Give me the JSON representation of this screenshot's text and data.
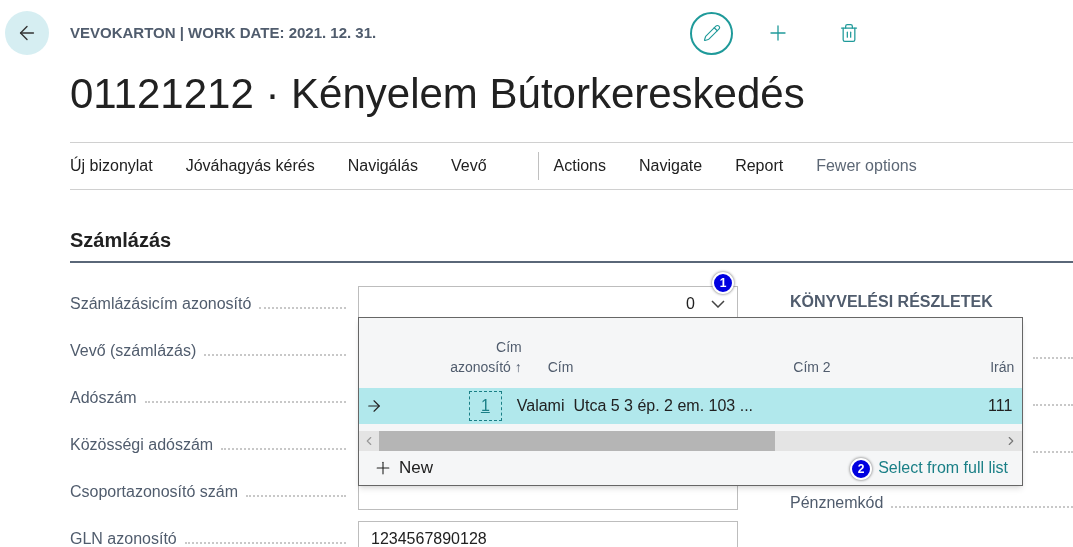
{
  "header": {
    "caption": "VEVOKARTON | WORK DATE: 2021. 12. 31.",
    "title": "01121212 · Kényelem Bútorkereskedés"
  },
  "actions": [
    {
      "label": "Új bizonylat",
      "kind": "promoted"
    },
    {
      "label": "Jóváhagyás kérés",
      "kind": "promoted"
    },
    {
      "label": "Navigálás",
      "kind": "promoted"
    },
    {
      "label": "Vevő",
      "kind": "promoted"
    },
    {
      "label": "Actions",
      "kind": "menu"
    },
    {
      "label": "Navigate",
      "kind": "menu"
    },
    {
      "label": "Report",
      "kind": "menu"
    },
    {
      "label": "Fewer options",
      "kind": "toggle"
    }
  ],
  "section": {
    "title": "Számlázás"
  },
  "fields": [
    {
      "label": "Számlázásicím azonosító",
      "value": "0",
      "kind": "dropdown"
    },
    {
      "label": "Vevő (számlázás)",
      "kind": "hidden"
    },
    {
      "label": "Adószám",
      "kind": "hidden"
    },
    {
      "label": "Közösségi adószám",
      "kind": "hidden"
    },
    {
      "label": "Csoportazonosító szám",
      "kind": "text"
    },
    {
      "label": "GLN azonosító",
      "value": "1234567890128",
      "kind": "text"
    }
  ],
  "right_group": {
    "title": "KÖNYVELÉSI RÉSZLETEK",
    "fields": [
      {
        "label": "Pénznemkód"
      }
    ]
  },
  "lookup": {
    "columns": [
      "Cím azonosító ↑",
      "Cím",
      "Cím 2",
      "Irán"
    ],
    "rows": [
      {
        "cells": [
          "1",
          "Valami  Utca 5 3 ép. 2 em. 103 ...",
          "",
          "111"
        ],
        "selected": true
      }
    ],
    "new_label": "New",
    "full_list_link": "Select from full list"
  },
  "markers": [
    "1",
    "2"
  ]
}
